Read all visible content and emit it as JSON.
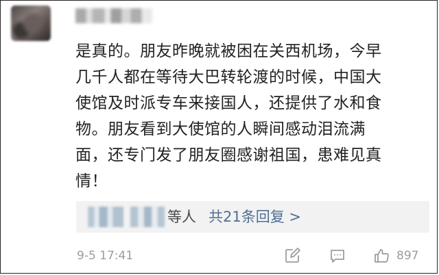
{
  "comment": {
    "lines": [
      "是真的。朋友昨晚就被困在关西机场，今早",
      "几千人都在等待大巴转轮渡的时候，中国大",
      "使馆及时派专车来接国人，还提供了水和食",
      "物。朋友看到大使馆的人瞬间感动泪流满",
      "面，还专门发了朋友圈感谢祖国，患难见真",
      "情！"
    ]
  },
  "replies": {
    "text": "等人",
    "link": "共21条回复 >"
  },
  "footer": {
    "timestamp": "9-5 17:41",
    "likes": "897"
  },
  "icons": {
    "edit": "edit-icon",
    "comment": "comment-icon",
    "like": "thumbs-up-icon"
  },
  "colors": {
    "text": "#222222",
    "link": "#4f6f93",
    "muted": "#9c9c9c",
    "reply_bg": "#f2f2f2"
  }
}
